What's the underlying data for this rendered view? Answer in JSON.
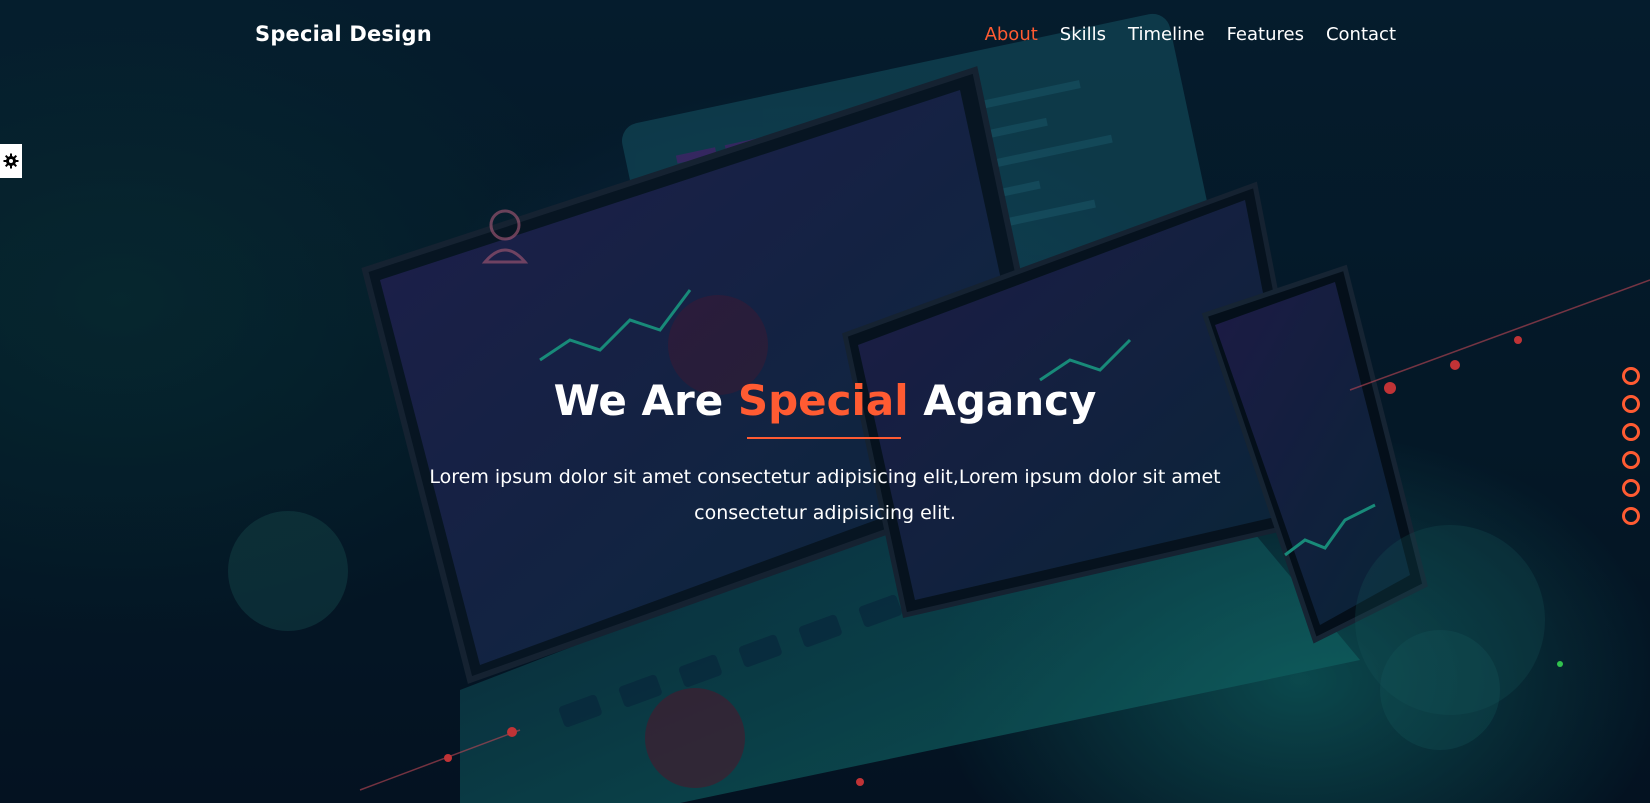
{
  "brand": {
    "name": "Special Design"
  },
  "nav": {
    "items": [
      {
        "label": "About",
        "active": true
      },
      {
        "label": "Skills",
        "active": false
      },
      {
        "label": "Timeline",
        "active": false
      },
      {
        "label": "Features",
        "active": false
      },
      {
        "label": "Contact",
        "active": false
      }
    ]
  },
  "hero": {
    "title_part1": "We Are ",
    "title_accent": "Special",
    "title_part2": " Agancy",
    "description": "Lorem ipsum dolor sit amet consectetur adipisicing elit,Lorem ipsum dolor sit amet consectetur adipisicing elit."
  },
  "settings": {
    "icon": "gear-icon"
  },
  "bullets": {
    "count": 6,
    "icon": "circle-outline"
  },
  "colors": {
    "accent": "#ff5b32",
    "text": "#ffffff",
    "background": "#05192b"
  }
}
